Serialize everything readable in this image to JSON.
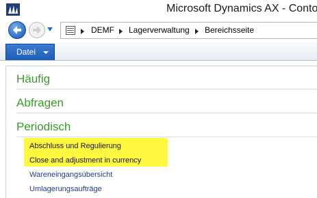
{
  "window": {
    "title": "Microsoft Dynamics AX - Contoso"
  },
  "nav": {
    "breadcrumb": [
      "DEMF",
      "Lagerverwaltung",
      "Bereichsseite"
    ]
  },
  "ribbon": {
    "file_tab_label": "Datei"
  },
  "area_page": {
    "sections": [
      "Häufig",
      "Abfragen",
      "Periodisch"
    ],
    "periodic_items": [
      "Abschluss und Regulierung",
      "Close and adjustment in currency",
      "Wareneingangsübersicht",
      "Umlagerungsaufträge"
    ],
    "highlighted_count": 2
  },
  "colors": {
    "section_header": "#3a9b2b",
    "link": "#1f3e8a",
    "highlight": "#fff740",
    "file_tab": "#1e5db5"
  }
}
